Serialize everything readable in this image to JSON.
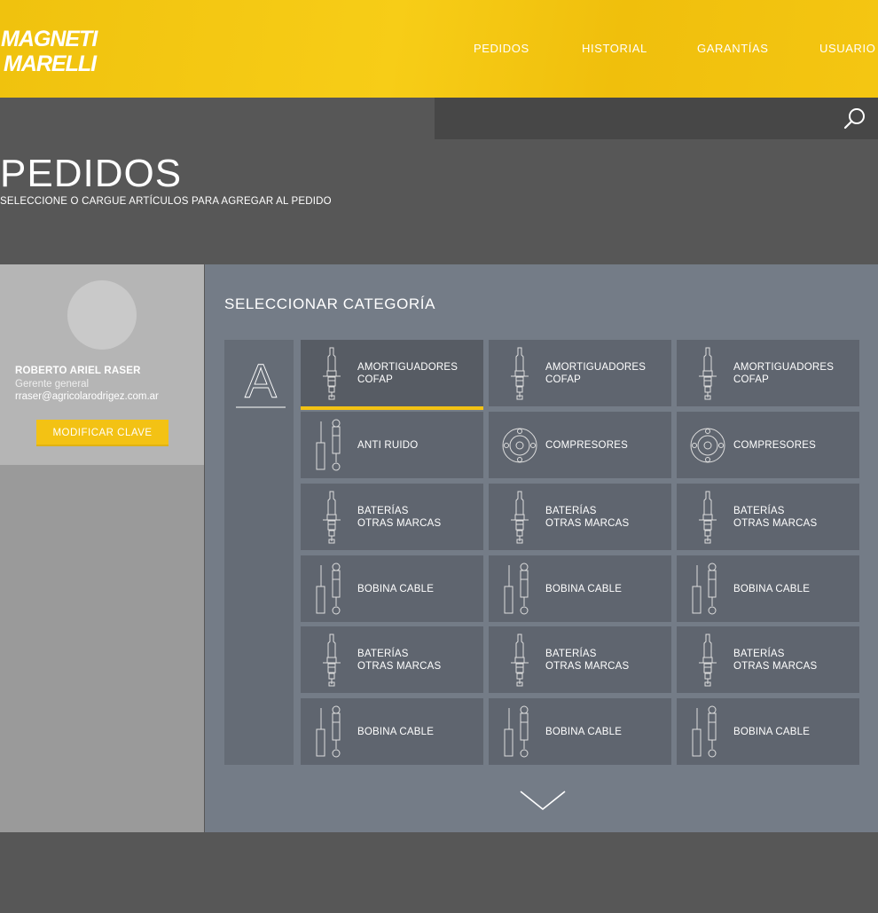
{
  "header": {
    "logo": {
      "line1": "MAGNETI",
      "line2": "MARELLI"
    },
    "nav": [
      {
        "label": "PEDIDOS"
      },
      {
        "label": "HISTORIAL"
      },
      {
        "label": "GARANTÍAS"
      },
      {
        "label": "USUARIO"
      }
    ]
  },
  "search": {
    "placeholder": "",
    "icon": "search-icon"
  },
  "page": {
    "title": "PEDIDOS",
    "subtitle": "SELECCIONE O CARGUE ARTÍCULOS PARA AGREGAR AL PEDIDO"
  },
  "user": {
    "name": "ROBERTO ARIEL RASER",
    "role": "Gerente general",
    "email": "rraser@agricolarodrigez.com.ar",
    "change_password_label": "MODIFICAR CLAVE"
  },
  "categories": {
    "title": "SELECCIONAR CATEGORÍA",
    "active_letter": "A",
    "items": [
      {
        "line1": "AMORTIGUADORES",
        "line2": "COFAP",
        "icon": "spark-plug-icon",
        "active": true
      },
      {
        "line1": "AMORTIGUADORES",
        "line2": "COFAP",
        "icon": "spark-plug-icon"
      },
      {
        "line1": "AMORTIGUADORES",
        "line2": "COFAP",
        "icon": "spark-plug-icon"
      },
      {
        "line1": "ANTI RUIDO",
        "line2": "",
        "icon": "shock-absorber-icon"
      },
      {
        "line1": "COMPRESORES",
        "line2": "",
        "icon": "compressor-icon"
      },
      {
        "line1": "COMPRESORES",
        "line2": "",
        "icon": "compressor-icon"
      },
      {
        "line1": "BATERÍAS",
        "line2": "OTRAS MARCAS",
        "icon": "spark-plug-icon"
      },
      {
        "line1": "BATERÍAS",
        "line2": "OTRAS MARCAS",
        "icon": "spark-plug-icon"
      },
      {
        "line1": "BATERÍAS",
        "line2": "OTRAS MARCAS",
        "icon": "spark-plug-icon"
      },
      {
        "line1": "BOBINA CABLE",
        "line2": "",
        "icon": "shock-absorber-icon"
      },
      {
        "line1": "BOBINA CABLE",
        "line2": "",
        "icon": "shock-absorber-icon"
      },
      {
        "line1": "BOBINA CABLE",
        "line2": "",
        "icon": "shock-absorber-icon"
      },
      {
        "line1": "BATERÍAS",
        "line2": "OTRAS MARCAS",
        "icon": "spark-plug-icon"
      },
      {
        "line1": "BATERÍAS",
        "line2": "OTRAS MARCAS",
        "icon": "spark-plug-icon"
      },
      {
        "line1": "BATERÍAS",
        "line2": "OTRAS MARCAS",
        "icon": "spark-plug-icon"
      },
      {
        "line1": "BOBINA CABLE",
        "line2": "",
        "icon": "shock-absorber-icon"
      },
      {
        "line1": "BOBINA CABLE",
        "line2": "",
        "icon": "shock-absorber-icon"
      },
      {
        "line1": "BOBINA CABLE",
        "line2": "",
        "icon": "shock-absorber-icon"
      }
    ]
  },
  "colors": {
    "brand_yellow": "#f3c214",
    "page_bg": "#575757",
    "panel_bg": "#747c87",
    "tile_bg": "#5f656f"
  }
}
